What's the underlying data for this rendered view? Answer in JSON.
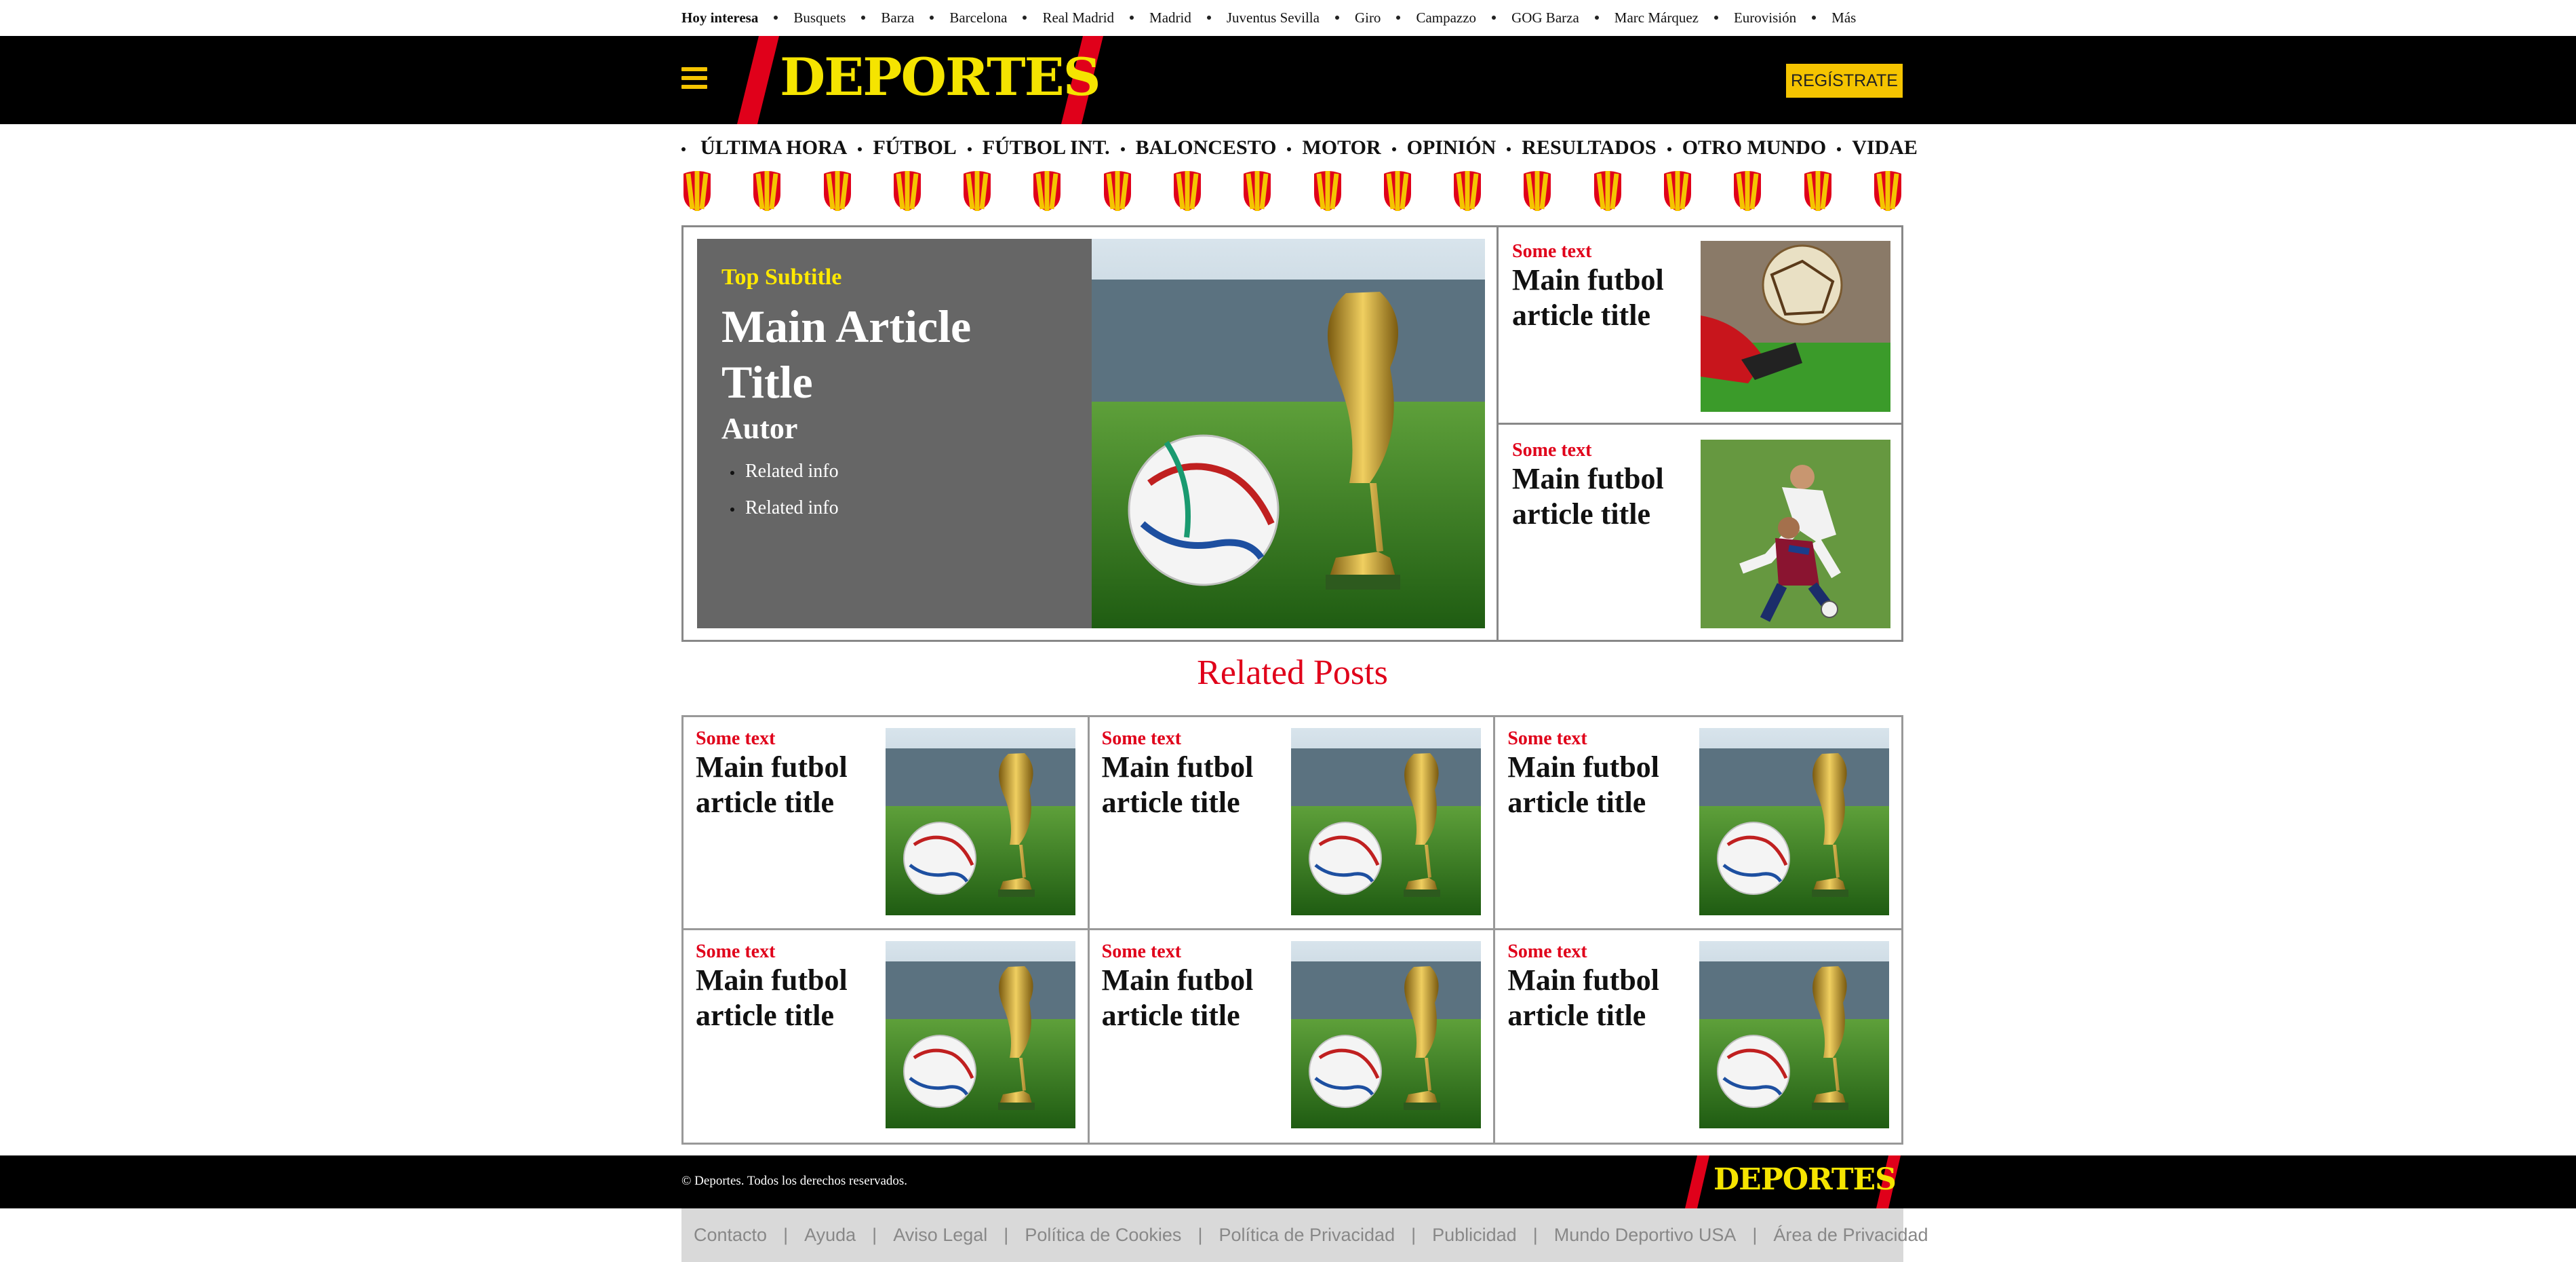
{
  "topbar": {
    "label": "Hoy interesa",
    "items": [
      "Busquets",
      "Barza",
      "Barcelona",
      "Real Madrid",
      "Madrid",
      "Juventus Sevilla",
      "Giro",
      "Campazzo",
      "GOG Barza",
      "Marc Márquez",
      "Eurovisión",
      "Más"
    ]
  },
  "header": {
    "logo_text": "DEPORTES",
    "register_label": "REGÍSTRATE",
    "menu_icon": "hamburger-icon",
    "brand_colors": {
      "yellow": "#f5e400",
      "red": "#e0001a",
      "black": "#000000"
    }
  },
  "nav": {
    "items": [
      "ÚLTIMA HORA",
      "FÚTBOL",
      "FÚTBOL INT.",
      "BALONCESTO",
      "MOTOR",
      "OPINIÓN",
      "RESULTADOS",
      "OTRO MUNDO",
      "VIDAE"
    ],
    "shield_icon": "team-shield-icon",
    "shield_count": 18
  },
  "hero": {
    "main": {
      "subtitle": "Top Subtitle",
      "title": "Main Article Title",
      "author": "Autor",
      "related": [
        "Related info",
        "Related info"
      ]
    },
    "side": [
      {
        "small": "Some text",
        "title": "Main futbol article title"
      },
      {
        "small": "Some text",
        "title": "Main futbol article title"
      }
    ]
  },
  "related": {
    "heading": "Related Posts",
    "posts": [
      {
        "small": "Some text",
        "title": "Main futbol article title"
      },
      {
        "small": "Some text",
        "title": "Main futbol article title"
      },
      {
        "small": "Some text",
        "title": "Main futbol article title"
      },
      {
        "small": "Some text",
        "title": "Main futbol article title"
      },
      {
        "small": "Some text",
        "title": "Main futbol article title"
      },
      {
        "small": "Some text",
        "title": "Main futbol article title"
      }
    ]
  },
  "footer": {
    "copyright": "© Deportes. Todos los derechos reservados.",
    "logo_text": "DEPORTES",
    "links": [
      "Contacto",
      "Ayuda",
      "Aviso Legal",
      "Política de Cookies",
      "Política de Privacidad",
      "Publicidad",
      "Mundo Deportivo USA",
      "Área de Privacidad"
    ]
  }
}
